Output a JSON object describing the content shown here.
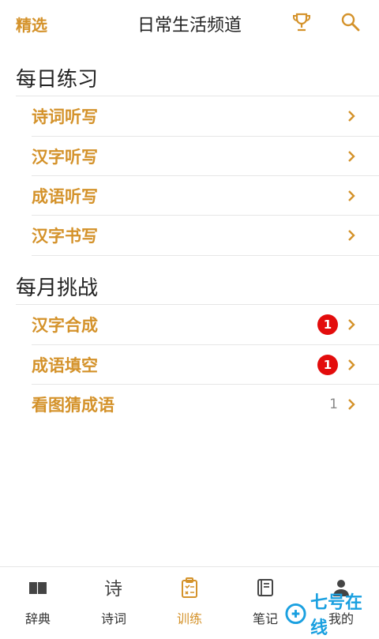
{
  "header": {
    "left_link": "精选",
    "title": "日常生活频道",
    "trophy_icon": "trophy-icon",
    "search_icon": "search-icon"
  },
  "sections": [
    {
      "title": "每日练习",
      "items": [
        {
          "label": "诗词听写"
        },
        {
          "label": "汉字听写"
        },
        {
          "label": "成语听写"
        },
        {
          "label": "汉字书写"
        }
      ]
    },
    {
      "title": "每月挑战",
      "items": [
        {
          "label": "汉字合成",
          "badge": "1"
        },
        {
          "label": "成语填空",
          "badge": "1"
        },
        {
          "label": "看图猜成语",
          "count": "1"
        }
      ]
    }
  ],
  "tabbar": {
    "items": [
      {
        "label": "辞典",
        "icon": "book-icon"
      },
      {
        "label": "诗词",
        "icon": "poem-icon"
      },
      {
        "label": "训练",
        "icon": "clipboard-icon",
        "active": true
      },
      {
        "label": "笔记",
        "icon": "notebook-icon"
      },
      {
        "label": "我的",
        "icon": "person-icon"
      }
    ]
  },
  "watermark": {
    "text": "七号在线"
  },
  "colors": {
    "accent": "#d4922a",
    "badge": "#e30c0c",
    "watermark": "#1aa0e0"
  }
}
